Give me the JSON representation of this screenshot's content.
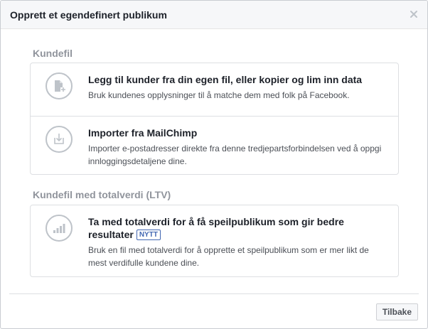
{
  "dialog": {
    "title": "Opprett et egendefinert publikum"
  },
  "sections": {
    "customer_file": {
      "label": "Kundefil",
      "options": [
        {
          "title": "Legg til kunder fra din egen fil, eller kopier og lim inn data",
          "description": "Bruk kundenes opplysninger til å matche dem med folk på Facebook.",
          "icon": "file-add-icon"
        },
        {
          "title": "Importer fra MailChimp",
          "description": "Importer e-postadresser direkte fra denne tredjepartsforbindelsen ved å oppgi innloggingsdetaljene dine.",
          "icon": "import-icon"
        }
      ]
    },
    "ltv_file": {
      "label": "Kundefil med totalverdi (LTV)",
      "options": [
        {
          "title": "Ta med totalverdi for å få speilpublikum som gir bedre resultater",
          "badge": "NYTT",
          "description": "Bruk en fil med totalverdi for å opprette et speilpublikum som er mer likt de mest verdifulle kundene dine.",
          "icon": "bar-chart-icon"
        }
      ]
    }
  },
  "footer": {
    "back_label": "Tilbake"
  }
}
